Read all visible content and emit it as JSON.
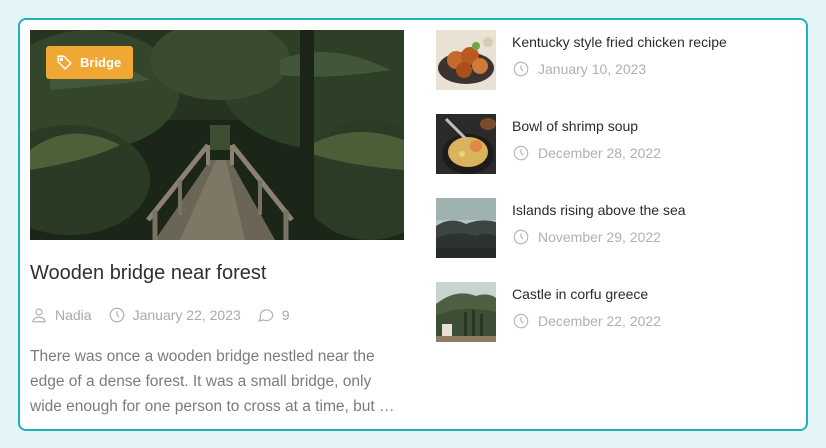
{
  "featured": {
    "tag": "Bridge",
    "title": "Wooden bridge near forest",
    "author": "Nadia",
    "date": "January 22, 2023",
    "comments": "9",
    "excerpt": "There was once a wooden bridge nestled near the edge of a dense forest. It was a small bridge, only wide enough for one person to cross at a time, but …",
    "image_icon": "forest-bridge-photo"
  },
  "posts": [
    {
      "title": "Kentucky style fried chicken recipe",
      "date": "January 10, 2023",
      "image_icon": "fried-chicken-photo"
    },
    {
      "title": "Bowl of shrimp soup",
      "date": "December 28, 2022",
      "image_icon": "shrimp-soup-photo"
    },
    {
      "title": "Islands rising above the sea",
      "date": "November 29, 2022",
      "image_icon": "islands-photo"
    },
    {
      "title": "Castle in corfu greece",
      "date": "December 22, 2022",
      "image_icon": "corfu-castle-photo"
    }
  ],
  "colors": {
    "border": "#1fb2bb",
    "tag_bg": "#f0a733",
    "page_bg": "#e3f5f6"
  }
}
